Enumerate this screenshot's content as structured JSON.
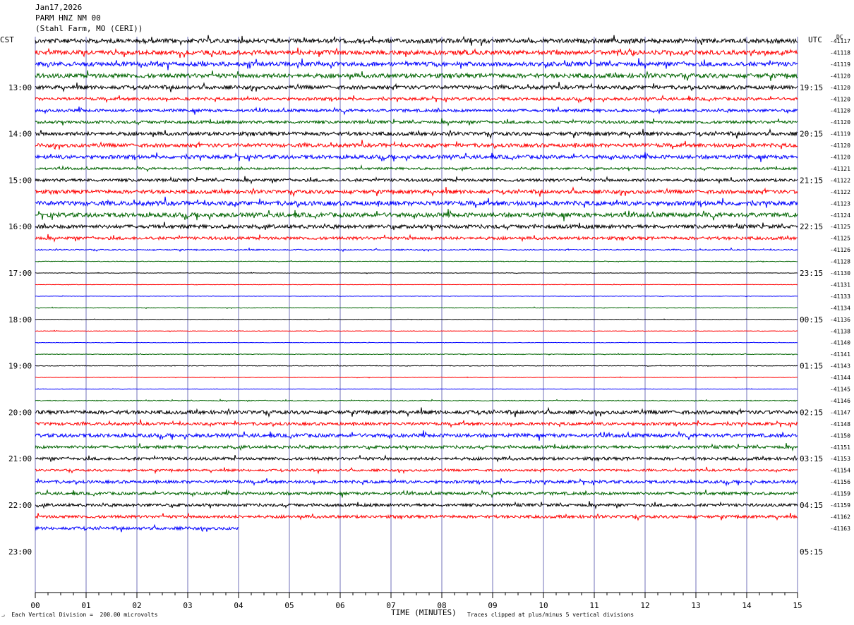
{
  "header": {
    "date": "Jan17,2026",
    "station": "PARM HNZ NM 00",
    "location": "(Stahl Farm, MO (CERI))"
  },
  "axes": {
    "left_label": "CST",
    "right_label": "UTC",
    "dc_label": "DC",
    "xlabel": "TIME (MINUTES)"
  },
  "footer": {
    "scale_note": "Each Vertical Division =  200.00 microvolts",
    "clip_note": "Traces clipped at plus/minus 5 vertical divisions"
  },
  "colors": {
    "cycle": [
      "#000000",
      "#ff0000",
      "#0000ff",
      "#006400"
    ],
    "grid": "#7070b8"
  },
  "chart_data": {
    "type": "helicorder",
    "title": "PARM HNZ NM 00",
    "x": {
      "ticks": [
        "00",
        "01",
        "02",
        "03",
        "04",
        "05",
        "06",
        "07",
        "08",
        "09",
        "10",
        "11",
        "12",
        "13",
        "14",
        "15"
      ],
      "range": [
        0,
        15
      ],
      "units": "minutes"
    },
    "cst_hour_labels": [
      "13:00",
      "14:00",
      "15:00",
      "16:00",
      "17:00",
      "18:00",
      "19:00",
      "20:00",
      "21:00",
      "22:00",
      "23:00"
    ],
    "utc_hour_labels": [
      "19:15",
      "20:15",
      "21:15",
      "22:15",
      "23:15",
      "00:15",
      "01:15",
      "02:15",
      "03:15",
      "04:15",
      "05:15"
    ],
    "traces": [
      {
        "dc": "-41117",
        "amp": 3,
        "len": 15
      },
      {
        "dc": "-41118",
        "amp": 3,
        "len": 15
      },
      {
        "dc": "-41119",
        "amp": 3,
        "len": 15
      },
      {
        "dc": "-41120",
        "amp": 3,
        "len": 15
      },
      {
        "dc": "-41120",
        "amp": 2.5,
        "len": 15
      },
      {
        "dc": "-41120",
        "amp": 2,
        "len": 15
      },
      {
        "dc": "-41120",
        "amp": 2,
        "len": 15
      },
      {
        "dc": "-41120",
        "amp": 2,
        "len": 15
      },
      {
        "dc": "-41119",
        "amp": 2.5,
        "len": 15
      },
      {
        "dc": "-41120",
        "amp": 2.5,
        "len": 15
      },
      {
        "dc": "-41120",
        "amp": 2.5,
        "len": 15
      },
      {
        "dc": "-41121",
        "amp": 1.5,
        "len": 15
      },
      {
        "dc": "-41122",
        "amp": 2,
        "len": 15
      },
      {
        "dc": "-41122",
        "amp": 2.5,
        "len": 15
      },
      {
        "dc": "-41123",
        "amp": 3,
        "len": 15
      },
      {
        "dc": "-41124",
        "amp": 3,
        "len": 15
      },
      {
        "dc": "-41125",
        "amp": 2.5,
        "len": 15
      },
      {
        "dc": "-41125",
        "amp": 2,
        "len": 15
      },
      {
        "dc": "-41126",
        "amp": 0.8,
        "len": 15
      },
      {
        "dc": "-41128",
        "amp": 0.4,
        "len": 15
      },
      {
        "dc": "-41130",
        "amp": 0.3,
        "len": 15
      },
      {
        "dc": "-41131",
        "amp": 0.3,
        "len": 15
      },
      {
        "dc": "-41133",
        "amp": 0.3,
        "len": 15
      },
      {
        "dc": "-41134",
        "amp": 0.4,
        "len": 15
      },
      {
        "dc": "-41136",
        "amp": 0.3,
        "len": 15
      },
      {
        "dc": "-41138",
        "amp": 0.3,
        "len": 15
      },
      {
        "dc": "-41140",
        "amp": 0.3,
        "len": 15
      },
      {
        "dc": "-41141",
        "amp": 0.4,
        "len": 15
      },
      {
        "dc": "-41143",
        "amp": 0.4,
        "len": 15
      },
      {
        "dc": "-41144",
        "amp": 0.3,
        "len": 15
      },
      {
        "dc": "-41145",
        "amp": 0.3,
        "len": 15
      },
      {
        "dc": "-41146",
        "amp": 0.6,
        "len": 15
      },
      {
        "dc": "-41147",
        "amp": 2.5,
        "len": 15
      },
      {
        "dc": "-41148",
        "amp": 2,
        "len": 15
      },
      {
        "dc": "-41150",
        "amp": 2.5,
        "len": 15
      },
      {
        "dc": "-41151",
        "amp": 2,
        "len": 15
      },
      {
        "dc": "-41153",
        "amp": 2,
        "len": 15
      },
      {
        "dc": "-41154",
        "amp": 1.5,
        "len": 15
      },
      {
        "dc": "-41156",
        "amp": 2,
        "len": 15
      },
      {
        "dc": "-41159",
        "amp": 2,
        "len": 15
      },
      {
        "dc": "-41159",
        "amp": 2,
        "len": 15
      },
      {
        "dc": "-41162",
        "amp": 2,
        "len": 15
      },
      {
        "dc": "-41163",
        "amp": 2,
        "len": 4
      }
    ]
  }
}
